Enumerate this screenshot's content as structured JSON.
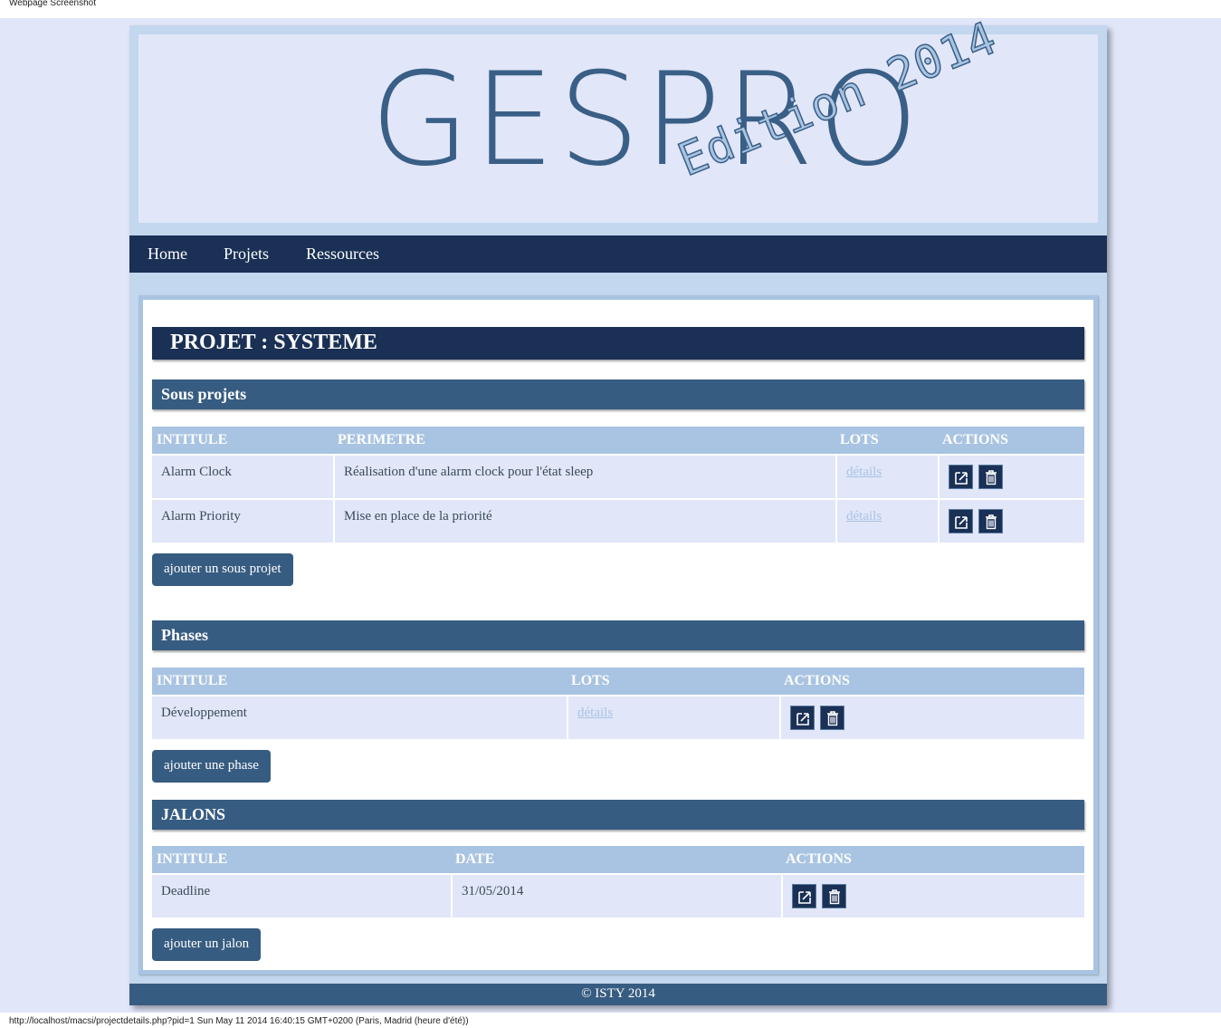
{
  "screenshot": {
    "title": "Webpage Screenshot",
    "status": "http://localhost/macsi/projectdetails.php?pid=1 Sun May 11 2014 16:40:15 GMT+0200 (Paris, Madrid (heure d'été))"
  },
  "banner": {
    "brand": "GESPRO",
    "edition": "Edition 2014"
  },
  "nav": {
    "items": [
      "Home",
      "Projets",
      "Ressources"
    ]
  },
  "project": {
    "title": "PROJET : SYSTEME"
  },
  "subprojects": {
    "title": "Sous projets",
    "headers": [
      "INTITULE",
      "PERIMETRE",
      "LOTS",
      "ACTIONS"
    ],
    "rows": [
      {
        "intitule": "Alarm Clock",
        "perimetre": "Réalisation d'une alarm clock pour l'état sleep",
        "lots": "détails"
      },
      {
        "intitule": "Alarm Priority",
        "perimetre": "Mise en place de la priorité",
        "lots": "détails"
      }
    ],
    "add_label": "ajouter un sous projet"
  },
  "phases": {
    "title": "Phases",
    "headers": [
      "INTITULE",
      "LOTS",
      "ACTIONS"
    ],
    "rows": [
      {
        "intitule": "Développement",
        "lots": "détails"
      }
    ],
    "add_label": "ajouter une phase"
  },
  "jalons": {
    "title": "JALONS",
    "headers": [
      "INTITULE",
      "DATE",
      "ACTIONS"
    ],
    "rows": [
      {
        "intitule": "Deadline",
        "date": "31/05/2014"
      }
    ],
    "add_label": "ajouter un jalon"
  },
  "icons": {
    "edit": "edit-icon",
    "delete": "trash-icon"
  },
  "footer": {
    "text": "© ISTY 2014"
  },
  "colors": {
    "navy": "#1a3055",
    "section": "#375c81",
    "header_cell": "#a9c4e2",
    "cell": "#e1e6f9",
    "background": "#e1e6f9"
  }
}
